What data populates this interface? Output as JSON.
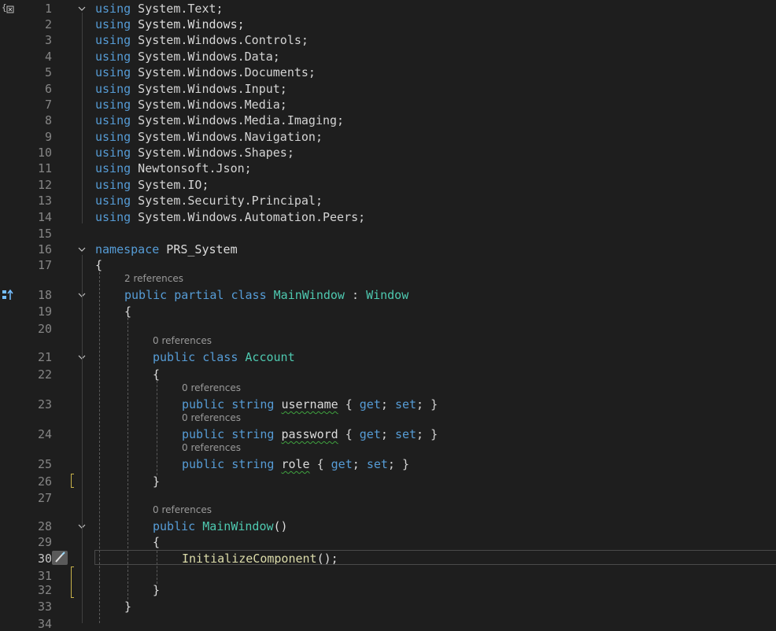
{
  "editor": {
    "active_line": "30",
    "lines": [
      {
        "number": "1",
        "tokens": [
          {
            "t": "using",
            "c": "kw"
          },
          {
            "t": " System.Text;",
            "c": "plain"
          }
        ]
      },
      {
        "number": "2",
        "tokens": [
          {
            "t": "using",
            "c": "kw"
          },
          {
            "t": " System.Windows;",
            "c": "id"
          }
        ]
      },
      {
        "number": "3",
        "tokens": [
          {
            "t": "using",
            "c": "kw"
          },
          {
            "t": " System.Windows.Controls;",
            "c": "plain"
          }
        ]
      },
      {
        "number": "4",
        "tokens": [
          {
            "t": "using",
            "c": "kw"
          },
          {
            "t": " System.Windows.Data;",
            "c": "plain"
          }
        ]
      },
      {
        "number": "5",
        "tokens": [
          {
            "t": "using",
            "c": "kw"
          },
          {
            "t": " System.Windows.Documents;",
            "c": "plain"
          }
        ]
      },
      {
        "number": "6",
        "tokens": [
          {
            "t": "using",
            "c": "kw"
          },
          {
            "t": " System.Windows.Input;",
            "c": "plain"
          }
        ]
      },
      {
        "number": "7",
        "tokens": [
          {
            "t": "using",
            "c": "kw"
          },
          {
            "t": " System.Windows.Media;",
            "c": "plain"
          }
        ]
      },
      {
        "number": "8",
        "tokens": [
          {
            "t": "using",
            "c": "kw"
          },
          {
            "t": " System.Windows.Media.Imaging;",
            "c": "plain"
          }
        ]
      },
      {
        "number": "9",
        "tokens": [
          {
            "t": "using",
            "c": "kw"
          },
          {
            "t": " System.Windows.Navigation;",
            "c": "plain"
          }
        ]
      },
      {
        "number": "10",
        "tokens": [
          {
            "t": "using",
            "c": "kw"
          },
          {
            "t": " System.Windows.Shapes;",
            "c": "plain"
          }
        ]
      },
      {
        "number": "11",
        "tokens": [
          {
            "t": "using",
            "c": "kw"
          },
          {
            "t": " Newtonsoft.Json;",
            "c": "plain"
          }
        ]
      },
      {
        "number": "12",
        "tokens": [
          {
            "t": "using",
            "c": "kw"
          },
          {
            "t": " System.IO;",
            "c": "plain"
          }
        ]
      },
      {
        "number": "13",
        "tokens": [
          {
            "t": "using",
            "c": "kw"
          },
          {
            "t": " System.Security.Principal;",
            "c": "plain"
          }
        ]
      },
      {
        "number": "14",
        "tokens": [
          {
            "t": "using",
            "c": "kw"
          },
          {
            "t": " System.Windows.Automation.Peers;",
            "c": "plain"
          }
        ]
      },
      {
        "number": "15",
        "tokens": []
      },
      {
        "number": "16",
        "tokens": [
          {
            "t": "namespace",
            "c": "kw"
          },
          {
            "t": " PRS_System",
            "c": "id"
          }
        ]
      },
      {
        "number": "17",
        "tokens": [
          {
            "t": "{",
            "c": "id"
          }
        ]
      },
      {
        "number": "18",
        "ref": "2 references",
        "tokens": [
          {
            "t": "public",
            "c": "kw"
          },
          {
            "t": " ",
            "c": "plain"
          },
          {
            "t": "partial",
            "c": "kw"
          },
          {
            "t": " ",
            "c": "plain"
          },
          {
            "t": "class",
            "c": "kw"
          },
          {
            "t": " ",
            "c": "plain"
          },
          {
            "t": "MainWindow",
            "c": "ty"
          },
          {
            "t": " : ",
            "c": "plain"
          },
          {
            "t": "Window",
            "c": "ty"
          }
        ]
      },
      {
        "number": "19",
        "tokens": [
          {
            "t": "{",
            "c": "id"
          }
        ]
      },
      {
        "number": "20",
        "tokens": []
      },
      {
        "number": "21",
        "ref": "0 references",
        "tokens": [
          {
            "t": "public",
            "c": "kw"
          },
          {
            "t": " ",
            "c": "plain"
          },
          {
            "t": "class",
            "c": "kw"
          },
          {
            "t": " ",
            "c": "plain"
          },
          {
            "t": "Account",
            "c": "ty"
          }
        ]
      },
      {
        "number": "22",
        "tokens": [
          {
            "t": "{",
            "c": "id"
          }
        ]
      },
      {
        "number": "23",
        "ref": "0 references",
        "tokens": [
          {
            "t": "public",
            "c": "kw"
          },
          {
            "t": " ",
            "c": "plain"
          },
          {
            "t": "string",
            "c": "kw"
          },
          {
            "t": " ",
            "c": "plain"
          },
          {
            "t": "username",
            "c": "idsq"
          },
          {
            "t": " { ",
            "c": "plain"
          },
          {
            "t": "get",
            "c": "kw"
          },
          {
            "t": "; ",
            "c": "plain"
          },
          {
            "t": "set",
            "c": "kw"
          },
          {
            "t": "; }",
            "c": "plain"
          }
        ]
      },
      {
        "number": "24",
        "ref": "0 references",
        "tokens": [
          {
            "t": "public",
            "c": "kw"
          },
          {
            "t": " ",
            "c": "plain"
          },
          {
            "t": "string",
            "c": "kw"
          },
          {
            "t": " ",
            "c": "plain"
          },
          {
            "t": "password",
            "c": "idsq"
          },
          {
            "t": " { ",
            "c": "plain"
          },
          {
            "t": "get",
            "c": "kw"
          },
          {
            "t": "; ",
            "c": "plain"
          },
          {
            "t": "set",
            "c": "kw"
          },
          {
            "t": "; }",
            "c": "plain"
          }
        ]
      },
      {
        "number": "25",
        "ref": "0 references",
        "tokens": [
          {
            "t": "public",
            "c": "kw"
          },
          {
            "t": " ",
            "c": "plain"
          },
          {
            "t": "string",
            "c": "kw"
          },
          {
            "t": " ",
            "c": "plain"
          },
          {
            "t": "role",
            "c": "idsq"
          },
          {
            "t": " { ",
            "c": "plain"
          },
          {
            "t": "get",
            "c": "kw"
          },
          {
            "t": "; ",
            "c": "plain"
          },
          {
            "t": "set",
            "c": "kw"
          },
          {
            "t": "; }",
            "c": "plain"
          }
        ]
      },
      {
        "number": "26",
        "tokens": [
          {
            "t": "}",
            "c": "id"
          }
        ]
      },
      {
        "number": "27",
        "tokens": []
      },
      {
        "number": "28",
        "ref": "0 references",
        "tokens": [
          {
            "t": "public",
            "c": "kw"
          },
          {
            "t": " ",
            "c": "plain"
          },
          {
            "t": "MainWindow",
            "c": "ty"
          },
          {
            "t": "()",
            "c": "id"
          }
        ]
      },
      {
        "number": "29",
        "tokens": [
          {
            "t": "{",
            "c": "id"
          }
        ]
      },
      {
        "number": "30",
        "tokens": [
          {
            "t": "InitializeComponent",
            "c": "fn"
          },
          {
            "t": "();",
            "c": "id"
          }
        ]
      },
      {
        "number": "31",
        "tokens": []
      },
      {
        "number": "32",
        "tokens": [
          {
            "t": "}",
            "c": "id"
          }
        ]
      },
      {
        "number": "33",
        "tokens": [
          {
            "t": "}",
            "c": "id"
          }
        ]
      },
      {
        "number": "34",
        "tokens": []
      }
    ]
  },
  "icons": {
    "margin_top": "namespace-brackets-icon",
    "margin_line18": "class-hierarchy-icon",
    "margin_line30": "paintbrush-quick-action-icon",
    "fold": "chevron-down-icon"
  },
  "colors": {
    "background": "#1e1e1e",
    "keyword": "#569cd6",
    "type": "#4ec9b0",
    "method": "#dcdcaa",
    "text": "#d4d4d4",
    "line_number": "#858585",
    "change_marker": "#c8b24a",
    "squiggle": "#3fa23f"
  }
}
